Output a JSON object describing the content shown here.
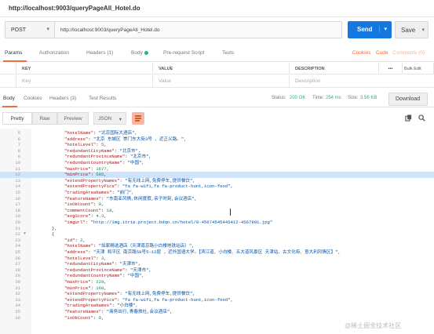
{
  "window": {
    "title": "http://localhost:9003/queryPageAll_Hotel.do"
  },
  "request": {
    "method": "POST",
    "url": "http://localhost:9003/queryPageAll_Hotel.do",
    "send_label": "Send",
    "save_label": "Save"
  },
  "request_tabs": [
    {
      "label": "Params",
      "active": true
    },
    {
      "label": "Authorization"
    },
    {
      "label": "Headers (1)"
    },
    {
      "label": "Body"
    },
    {
      "label": "Pre-request Script"
    },
    {
      "label": "Tests"
    }
  ],
  "request_links": {
    "cookies": "Cookies",
    "code": "Code",
    "comments": "Comments (0)"
  },
  "params_table": {
    "headers": [
      "KEY",
      "VALUE",
      "DESCRIPTION"
    ],
    "more": "•••",
    "bulk_edit": "Bulk Edit",
    "placeholders": [
      "Key",
      "Value",
      "Description"
    ]
  },
  "response_tabs": [
    {
      "label": "Body",
      "active": true
    },
    {
      "label": "Cookies"
    },
    {
      "label": "Headers (3)"
    },
    {
      "label": "Test Results"
    }
  ],
  "response_status": {
    "status_label": "Status:",
    "status": "200 OK",
    "time_label": "Time:",
    "time": "254 ms",
    "size_label": "Size:",
    "size": "3.56 KB"
  },
  "download_label": "Download",
  "view_modes": [
    "Pretty",
    "Raw",
    "Preview"
  ],
  "format": "JSON",
  "code_lines": [
    {
      "n": "5",
      "parts": [
        [
          "k",
          "\"hotelName\""
        ],
        [
          "p",
          ": "
        ],
        [
          "s",
          "\"北京国际大酒店\","
        ]
      ]
    },
    {
      "n": "6",
      "parts": [
        [
          "k",
          "\"address\""
        ],
        [
          "p",
          ": "
        ],
        [
          "s",
          "\"北京 东城区 崇门东大街3号 ，近正义路。\","
        ]
      ]
    },
    {
      "n": "7",
      "parts": [
        [
          "k",
          "\"hotelLevel\""
        ],
        [
          "p",
          ": "
        ],
        [
          "n",
          "5"
        ],
        [
          "p",
          ","
        ]
      ]
    },
    {
      "n": "8",
      "parts": [
        [
          "k",
          "\"redundantCityName\""
        ],
        [
          "p",
          ": "
        ],
        [
          "s",
          "\"北京市\","
        ]
      ]
    },
    {
      "n": "9",
      "parts": [
        [
          "k",
          "\"redundantProvinceName\""
        ],
        [
          "p",
          ": "
        ],
        [
          "s",
          "\"北京市\","
        ]
      ]
    },
    {
      "n": "10",
      "parts": [
        [
          "k",
          "\"redundantCountryName\""
        ],
        [
          "p",
          ": "
        ],
        [
          "s",
          "\"中国\","
        ]
      ]
    },
    {
      "n": "11",
      "parts": [
        [
          "k",
          "\"maxPrice\""
        ],
        [
          "p",
          ": "
        ],
        [
          "n",
          "1677"
        ],
        [
          "p",
          ","
        ]
      ]
    },
    {
      "n": "12",
      "hl": true,
      "parts": [
        [
          "k",
          "\"minPrice\""
        ],
        [
          "p",
          ": "
        ],
        [
          "n",
          "585"
        ],
        [
          "p",
          ","
        ]
      ]
    },
    {
      "n": "13",
      "parts": [
        [
          "k",
          "\"extendPropertyNames\""
        ],
        [
          "p",
          ": "
        ],
        [
          "s",
          "\"有无线上网,免费停车,提供餐饮\","
        ]
      ]
    },
    {
      "n": "14",
      "parts": [
        [
          "k",
          "\"extendPropertyPics\""
        ],
        [
          "p",
          ": "
        ],
        [
          "s",
          "\"fa fa-wifi,fa fa-product-hunt,icon-food\","
        ]
      ]
    },
    {
      "n": "15",
      "parts": [
        [
          "k",
          "\"tradingAreaNames\""
        ],
        [
          "p",
          ": "
        ],
        [
          "s",
          "\"前门\","
        ]
      ]
    },
    {
      "n": "16",
      "parts": [
        [
          "k",
          "\"featureNames\""
        ],
        [
          "p",
          ": "
        ],
        [
          "s",
          "\"东南亚风情,休闲度假,亲子时刻,会议酒店\","
        ]
      ]
    },
    {
      "n": "17",
      "parts": [
        [
          "k",
          "\"isOkCount\""
        ],
        [
          "p",
          ": "
        ],
        [
          "n",
          "0"
        ],
        [
          "p",
          ","
        ]
      ]
    },
    {
      "n": "18",
      "parts": [
        [
          "k",
          "\"commentCount\""
        ],
        [
          "p",
          ": "
        ],
        [
          "n",
          "18"
        ],
        [
          "p",
          ","
        ]
      ]
    },
    {
      "n": "19",
      "parts": [
        [
          "k",
          "\"avgScore\""
        ],
        [
          "p",
          ": "
        ],
        [
          "n",
          "4.3"
        ],
        [
          "p",
          ","
        ]
      ]
    },
    {
      "n": "20",
      "parts": [
        [
          "k",
          "\"imgUrl\""
        ],
        [
          "p",
          ": "
        ],
        [
          "s",
          "\"http://img.itrip.project.bdqn.cn/hotel/8-45674545445412-4567891.jpg\""
        ]
      ]
    },
    {
      "n": "21",
      "indent": "fold",
      "parts": [
        [
          "p",
          "},"
        ]
      ]
    },
    {
      "n": "22",
      "indent": "fold",
      "fold": "▼",
      "parts": [
        [
          "p",
          "{"
        ]
      ]
    },
    {
      "n": "23",
      "parts": [
        [
          "k",
          "\"id\""
        ],
        [
          "p",
          ": "
        ],
        [
          "n",
          "2"
        ],
        [
          "p",
          ","
        ]
      ]
    },
    {
      "n": "24",
      "parts": [
        [
          "k",
          "\"hotelName\""
        ],
        [
          "p",
          ": "
        ],
        [
          "s",
          "\"如家精选酒店（天津南京路小白楼地铁站店）\","
        ]
      ]
    },
    {
      "n": "25",
      "parts": [
        [
          "k",
          "\"address\""
        ],
        [
          "p",
          ": "
        ],
        [
          "s",
          "\"天津 和平区 南京路59号5-12层 ，近外国语大学。【滨江道、小白楼、五大道风景区 天津站、古文化街、意大利风情区】\","
        ]
      ]
    },
    {
      "n": "26",
      "parts": [
        [
          "k",
          "\"hotelLevel\""
        ],
        [
          "p",
          ": "
        ],
        [
          "n",
          "3"
        ],
        [
          "p",
          ","
        ]
      ]
    },
    {
      "n": "27",
      "parts": [
        [
          "k",
          "\"redundantCityName\""
        ],
        [
          "p",
          ": "
        ],
        [
          "s",
          "\"天津市\","
        ]
      ]
    },
    {
      "n": "28",
      "parts": [
        [
          "k",
          "\"redundantProvinceName\""
        ],
        [
          "p",
          ": "
        ],
        [
          "s",
          "\"天津市\","
        ]
      ]
    },
    {
      "n": "29",
      "parts": [
        [
          "k",
          "\"redundantCountryName\""
        ],
        [
          "p",
          ": "
        ],
        [
          "s",
          "\"中国\","
        ]
      ]
    },
    {
      "n": "30",
      "parts": [
        [
          "k",
          "\"maxPrice\""
        ],
        [
          "p",
          ": "
        ],
        [
          "n",
          "228"
        ],
        [
          "p",
          ","
        ]
      ]
    },
    {
      "n": "31",
      "parts": [
        [
          "k",
          "\"minPrice\""
        ],
        [
          "p",
          ": "
        ],
        [
          "n",
          "168"
        ],
        [
          "p",
          ","
        ]
      ]
    },
    {
      "n": "32",
      "parts": [
        [
          "k",
          "\"extendPropertyNames\""
        ],
        [
          "p",
          ": "
        ],
        [
          "s",
          "\"有无线上网,免费停车,提供餐饮\","
        ]
      ]
    },
    {
      "n": "33",
      "parts": [
        [
          "k",
          "\"extendPropertyPics\""
        ],
        [
          "p",
          ": "
        ],
        [
          "s",
          "\"fa fa-wifi,fa fa-product-hunt,icon-food\","
        ]
      ]
    },
    {
      "n": "34",
      "parts": [
        [
          "k",
          "\"tradingAreaNames\""
        ],
        [
          "p",
          ": "
        ],
        [
          "s",
          "\"小白楼\","
        ]
      ]
    },
    {
      "n": "35",
      "parts": [
        [
          "k",
          "\"featureNames\""
        ],
        [
          "p",
          ": "
        ],
        [
          "s",
          "\"商务出行,青春旅社,会议酒店\","
        ]
      ]
    },
    {
      "n": "36",
      "parts": [
        [
          "k",
          "\"isOkCount\""
        ],
        [
          "p",
          ": "
        ],
        [
          "n",
          "0"
        ],
        [
          "p",
          ","
        ]
      ]
    }
  ],
  "watermark": "@稀土掘金技术社区",
  "colors": {
    "send": "#1478de",
    "accent": "#f26b3a",
    "status_green": "#26b47f"
  }
}
